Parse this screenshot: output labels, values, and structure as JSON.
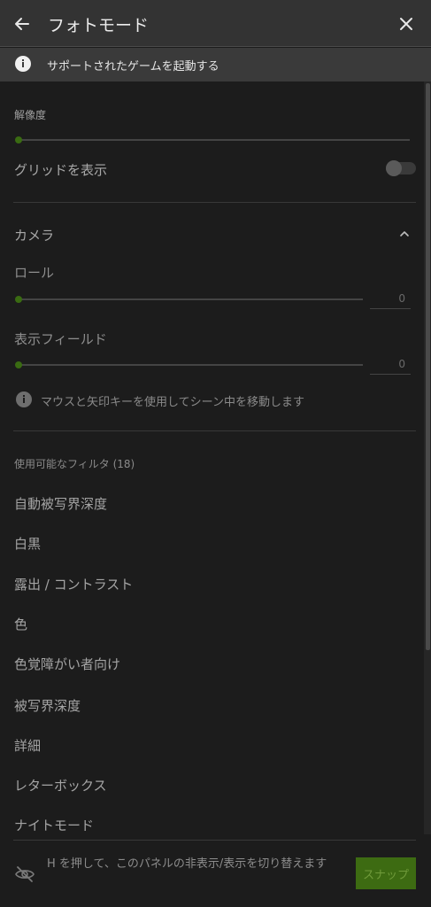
{
  "header": {
    "title": "フォトモード"
  },
  "banner": {
    "text": "サポートされたゲームを起動する"
  },
  "resolution": {
    "label": "解像度"
  },
  "grid": {
    "label": "グリッドを表示",
    "enabled": false
  },
  "camera": {
    "section_label": "カメラ",
    "roll": {
      "label": "ロール",
      "value": "0"
    },
    "fov": {
      "label": "表示フィールド",
      "value": "0"
    },
    "hint": "マウスと矢印キーを使用してシーン中を移動します"
  },
  "filters": {
    "header": "使用可能なフィルタ (18)",
    "items": [
      "自動被写界深度",
      "白黒",
      "露出 / コントラスト",
      "色",
      "色覚障がい者向け",
      "被写界深度",
      "詳細",
      "レターボックス",
      "ナイトモード"
    ]
  },
  "footer": {
    "hint": "H を押して、このパネルの非表示/表示を切り替えます",
    "snap_label": "スナップ"
  },
  "colors": {
    "accent": "#3d6b12",
    "header_bg": "#333333",
    "panel_bg": "#1c1c1c"
  }
}
